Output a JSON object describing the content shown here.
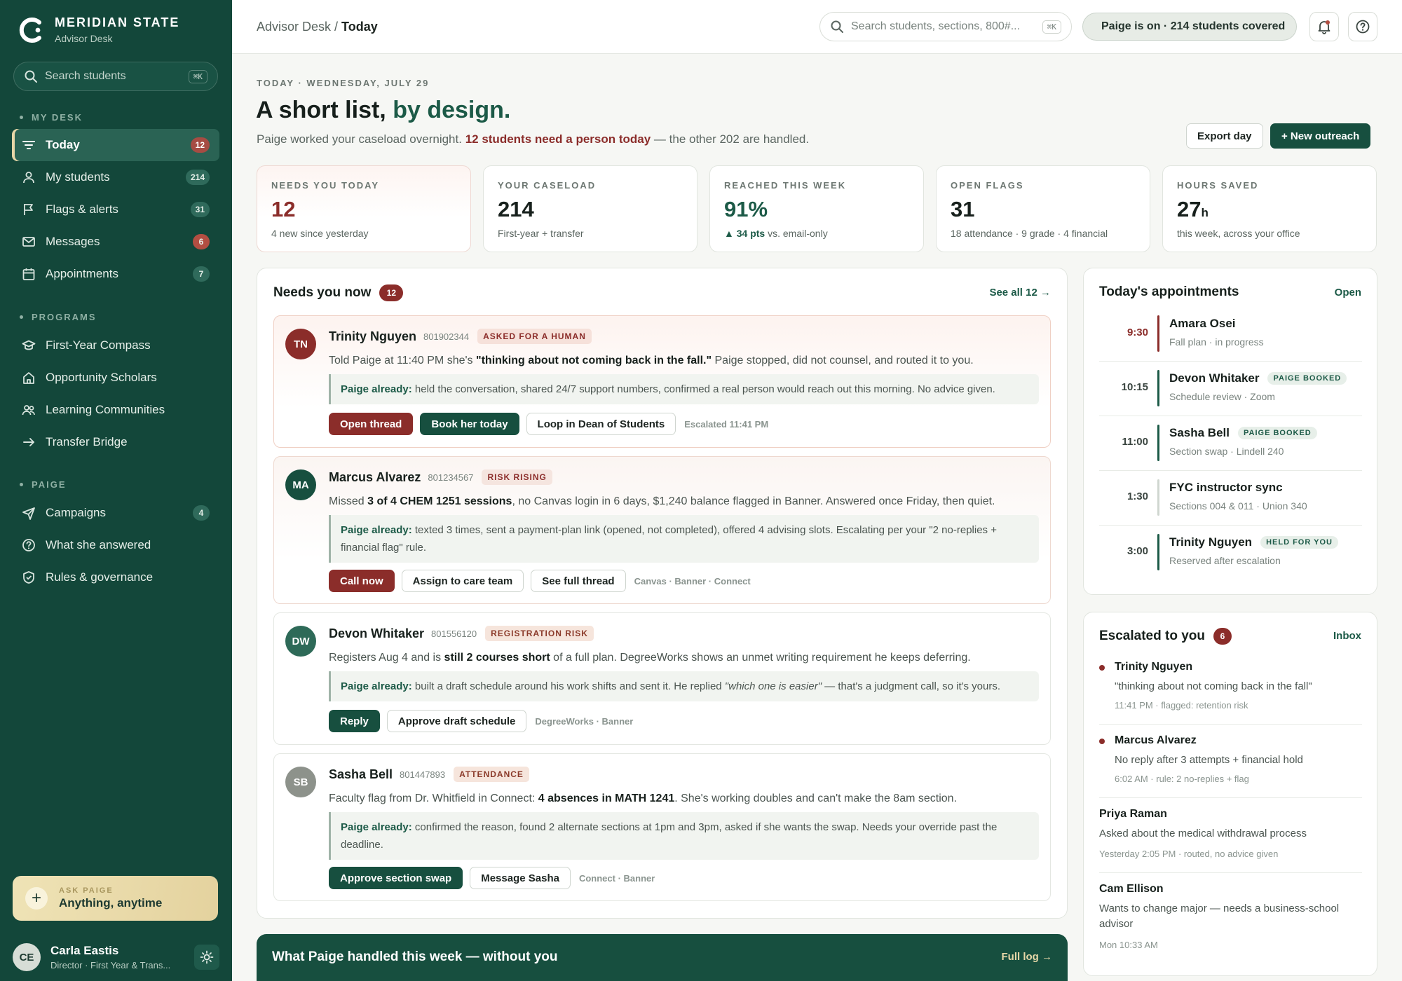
{
  "brand": {
    "name": "MERIDIAN STATE",
    "sub": "Advisor Desk"
  },
  "sidebar": {
    "search_placeholder": "Search students",
    "search_kbd": "⌘K",
    "sections": {
      "desk": "MY DESK",
      "programs": "PROGRAMS",
      "paige": "PAIGE"
    },
    "desk_items": [
      {
        "label": "Today",
        "count": "12",
        "icon": "today-icon"
      },
      {
        "label": "My students",
        "count": "214",
        "icon": "user-icon"
      },
      {
        "label": "Flags & alerts",
        "count": "31",
        "icon": "flag-icon"
      },
      {
        "label": "Messages",
        "count": "6",
        "icon": "mail-icon"
      },
      {
        "label": "Appointments",
        "count": "7",
        "icon": "calendar-icon"
      }
    ],
    "program_items": [
      {
        "label": "First-Year Compass",
        "icon": "graduation-cap-icon"
      },
      {
        "label": "Opportunity Scholars",
        "icon": "home-icon"
      },
      {
        "label": "Learning Communities",
        "icon": "group-icon"
      },
      {
        "label": "Transfer Bridge",
        "icon": "arrow-right-icon"
      }
    ],
    "paige_items": [
      {
        "label": "Campaigns",
        "count": "4",
        "icon": "send-icon"
      },
      {
        "label": "What she answered",
        "icon": "help-circle-icon"
      },
      {
        "label": "Rules & governance",
        "icon": "shield-icon"
      }
    ],
    "ask": {
      "label": "ASK PAIGE",
      "main": "Anything, anytime"
    },
    "user": {
      "initials": "CE",
      "name": "Carla Eastis",
      "role": "Director · First Year & Trans..."
    }
  },
  "topbar": {
    "breadcrumb_root": "Advisor Desk",
    "breadcrumb_sep": " / ",
    "breadcrumb_current": "Today",
    "search_placeholder": "Search students, sections, 800#...",
    "search_kbd": "⌘K",
    "status": "Paige is on · 214 students covered"
  },
  "header": {
    "eyebrow": "TODAY · WEDNESDAY, JULY 29",
    "title_a": "A short list, ",
    "title_b": "by design.",
    "sub_a": "Paige worked your caseload overnight. ",
    "sub_em": "12 students need a person today",
    "sub_b": " — the other 202 are handled.",
    "export": "Export day",
    "new_outreach": "+ New outreach"
  },
  "stats": [
    {
      "label": "NEEDS YOU TODAY",
      "value": "12",
      "unit": "",
      "note": "4 new since yesterday",
      "note_em": ""
    },
    {
      "label": "YOUR CASELOAD",
      "value": "214",
      "unit": "",
      "note": "First-year + transfer",
      "note_em": ""
    },
    {
      "label": "REACHED THIS WEEK",
      "value": "91%",
      "unit": "",
      "note": " vs. email-only",
      "note_em": "▲ 34 pts"
    },
    {
      "label": "OPEN FLAGS",
      "value": "31",
      "unit": "",
      "note": "18 attendance · 9 grade · 4 financial",
      "note_em": ""
    },
    {
      "label": "HOURS SAVED",
      "value": "27",
      "unit": "h",
      "note": "this week, across your office",
      "note_em": ""
    }
  ],
  "needs": {
    "title": "Needs you now",
    "count": "12",
    "see_all": "See all 12 →",
    "cards": [
      {
        "initials": "TN",
        "name": "Trinity Nguyen",
        "id": "801902344",
        "tag": "ASKED FOR A HUMAN",
        "text_a": "Told Paige at 11:40 PM she's ",
        "text_b": "\"thinking about not coming back in the fall.\"",
        "text_c": " Paige stopped, did not counsel, and routed it to you.",
        "paige_label": "Paige already:",
        "paige_text": " held the conversation, shared 24/7 support numbers, confirmed a real person would reach out this morning. No advice given.",
        "actions": [
          "Open thread",
          "Book her today",
          "Loop in Dean of Students"
        ],
        "meta": "Escalated 11:41 PM"
      },
      {
        "initials": "MA",
        "name": "Marcus Alvarez",
        "id": "801234567",
        "tag": "RISK RISING",
        "text_a": "Missed ",
        "text_b": "3 of 4 CHEM 1251 sessions",
        "text_c": ", no Canvas login in 6 days, $1,240 balance flagged in Banner. Answered once Friday, then quiet.",
        "paige_label": "Paige already:",
        "paige_text": " texted 3 times, sent a payment-plan link (opened, not completed), offered 4 advising slots. Escalating per your \"2 no-replies + financial flag\" rule.",
        "actions": [
          "Call now",
          "Assign to care team",
          "See full thread"
        ],
        "meta": "Canvas · Banner · Connect"
      },
      {
        "initials": "DW",
        "name": "Devon Whitaker",
        "id": "801556120",
        "tag": "REGISTRATION RISK",
        "text_a": "Registers Aug 4 and is ",
        "text_b": "still 2 courses short",
        "text_c": " of a full plan. DegreeWorks shows an unmet writing requirement he keeps deferring.",
        "paige_label": "Paige already:",
        "paige_text_a": " built a draft schedule around his work shifts and sent it. He replied ",
        "paige_quote": "\"which one is easier\"",
        "paige_text_b": " — that's a judgment call, so it's yours.",
        "actions": [
          "Reply",
          "Approve draft schedule"
        ],
        "meta": "DegreeWorks · Banner"
      },
      {
        "initials": "SB",
        "name": "Sasha Bell",
        "id": "801447893",
        "tag": "ATTENDANCE",
        "text_a": "Faculty flag from Dr. Whitfield in Connect: ",
        "text_b": "4 absences in MATH 1241",
        "text_c": ". She's working doubles and can't make the 8am section.",
        "paige_label": "Paige already:",
        "paige_text": " confirmed the reason, found 2 alternate sections at 1pm and 3pm, asked if she wants the swap. Needs your override past the deadline.",
        "actions": [
          "Approve section swap",
          "Message Sasha"
        ],
        "meta": "Connect · Banner"
      }
    ]
  },
  "appointments": {
    "title": "Today's appointments",
    "link": "Open",
    "items": [
      {
        "time": "9:30",
        "name": "Amara Osei",
        "sub": "Fall plan · in progress",
        "tag": ""
      },
      {
        "time": "10:15",
        "name": "Devon Whitaker",
        "sub": "Schedule review · Zoom",
        "tag": "PAIGE BOOKED"
      },
      {
        "time": "11:00",
        "name": "Sasha Bell",
        "sub": "Section swap · Lindell 240",
        "tag": "PAIGE BOOKED"
      },
      {
        "time": "1:30",
        "name": "FYC instructor sync",
        "sub": "Sections 004 & 011 · Union 340",
        "tag": ""
      },
      {
        "time": "3:00",
        "name": "Trinity Nguyen",
        "sub": "Reserved after escalation",
        "tag": "HELD FOR YOU"
      }
    ]
  },
  "escalated": {
    "title": "Escalated to you",
    "count": "6",
    "link": "Inbox",
    "items": [
      {
        "name": "Trinity Nguyen",
        "text": "\"thinking about not coming back in the fall\"",
        "meta": "11:41 PM · flagged: retention risk"
      },
      {
        "name": "Marcus Alvarez",
        "text": "No reply after 3 attempts + financial hold",
        "meta": "6:02 AM · rule: 2 no-replies + flag"
      },
      {
        "name": "Priya Raman",
        "text": "Asked about the medical withdrawal process",
        "meta": "Yesterday 2:05 PM · routed, no advice given"
      },
      {
        "name": "Cam Ellison",
        "text": "Wants to change major — needs a business-school advisor",
        "meta": "Mon 10:33 AM"
      }
    ]
  },
  "handled": {
    "title": "What Paige handled this week — without you",
    "link": "Full log →"
  },
  "colors": {
    "sidebar": "#13473a",
    "brand_green": "#174f3f",
    "alert_red": "#8b2d2a",
    "accent_gold": "#e7d7a8"
  }
}
